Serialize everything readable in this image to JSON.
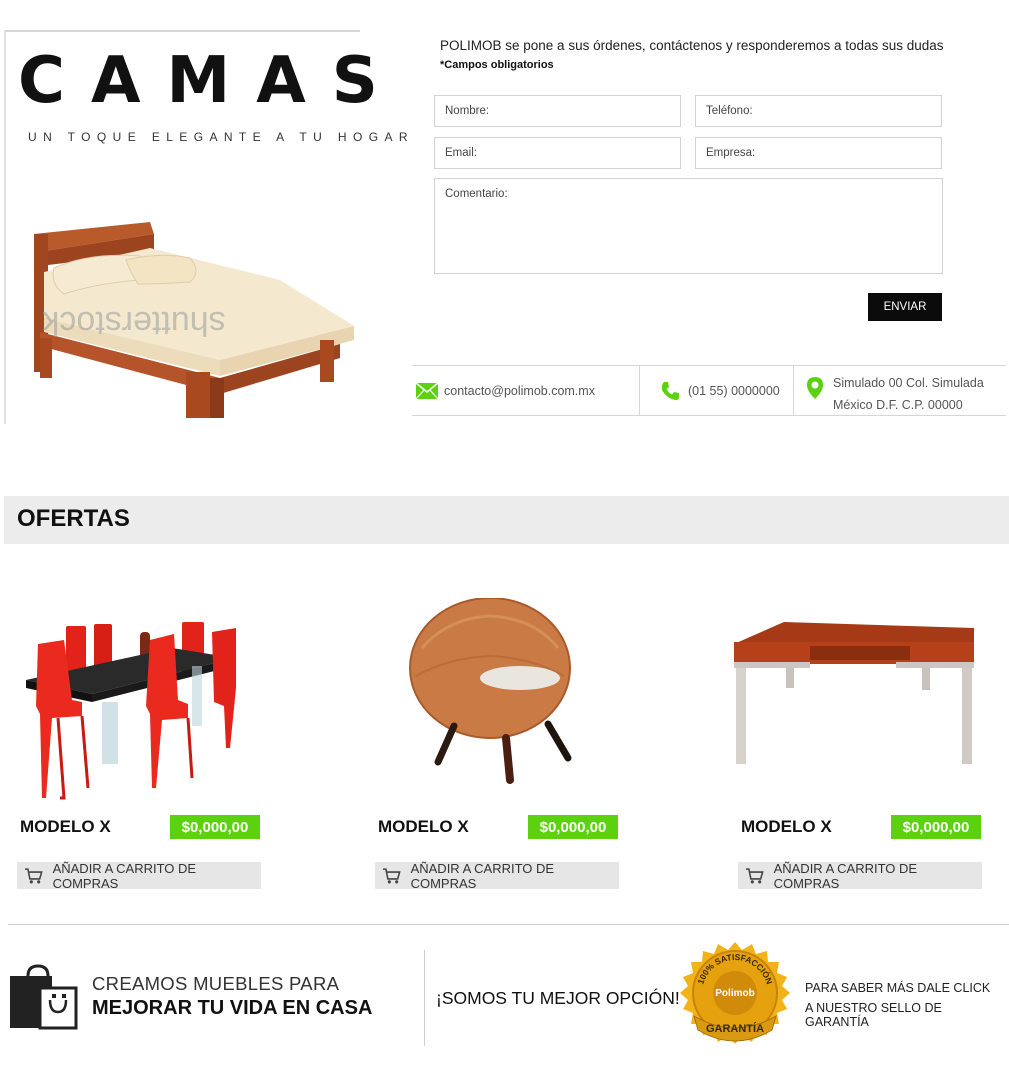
{
  "hero": {
    "title": "CAMAS",
    "subtitle": "UN TOQUE ELEGANTE A TU HOGAR",
    "watermark": "shutterstock"
  },
  "contact_form": {
    "intro": "POLIMOB se pone a sus órdenes, contáctenos y responderemos a todas sus dudas",
    "required_note": "*Campos obligatorios",
    "name_label": "Nombre:",
    "phone_label": "Teléfono:",
    "email_label": "Email:",
    "company_label": "Empresa:",
    "comment_label": "Comentario:",
    "submit_label": "ENVIAR"
  },
  "contact_info": {
    "email": "contacto@polimob.com.mx",
    "phone": "(01 55) 0000000",
    "address_line1": "Simulado 00 Col. Simulada",
    "address_line2": "México D.F. C.P. 00000"
  },
  "offers": {
    "heading": "OFERTAS",
    "products": [
      {
        "name": "MODELO X",
        "price": "$0,000,00",
        "cart_label": "AÑADIR A CARRITO DE COMPRAS"
      },
      {
        "name": "MODELO X",
        "price": "$0,000,00",
        "cart_label": "AÑADIR A CARRITO DE COMPRAS"
      },
      {
        "name": "MODELO X",
        "price": "$0,000,00",
        "cart_label": "AÑADIR A CARRITO DE COMPRAS"
      }
    ]
  },
  "footer": {
    "tagline_line1": "CREAMOS MUEBLES PARA",
    "tagline_line2": "MEJORAR TU VIDA EN CASA",
    "slogan": "¡SOMOS TU MEJOR OPCIÓN!",
    "seal": {
      "ring_text": "100% SATISFACCIÓN",
      "brand": "Polimob",
      "ribbon": "GARANTÍA"
    },
    "guarantee_line1": "PARA SABER MÁS DALE CLICK",
    "guarantee_line2": "A NUESTRO SELLO DE GARANTÍA"
  },
  "colors": {
    "accent_green": "#5cd10f",
    "dark": "#0b0b0b",
    "wood": "#b5542a",
    "gold": "#f2b21a"
  },
  "icons": [
    "envelope-icon",
    "phone-icon",
    "map-pin-icon",
    "cart-icon",
    "shopping-bag-icon"
  ]
}
